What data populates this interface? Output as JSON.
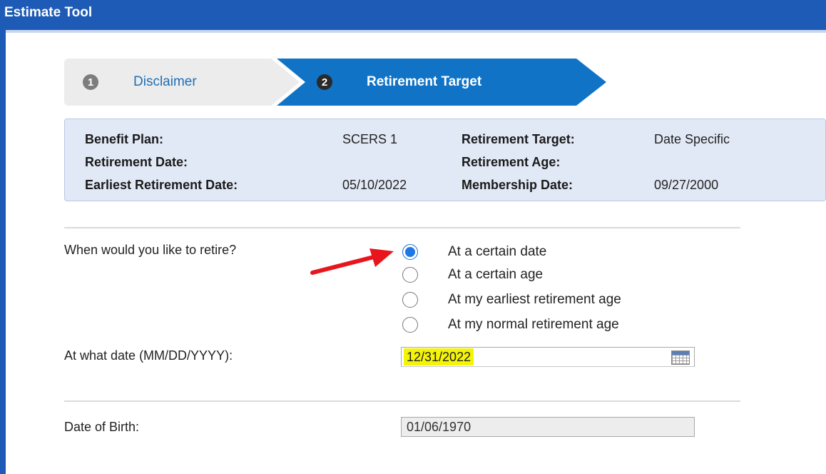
{
  "window": {
    "title": "Estimate Tool"
  },
  "steps": [
    {
      "number": "1",
      "label": "Disclaimer"
    },
    {
      "number": "2",
      "label": "Retirement Target"
    }
  ],
  "summary": {
    "benefit_plan_label": "Benefit Plan:",
    "benefit_plan_value": "SCERS 1",
    "retirement_target_label": "Retirement Target:",
    "retirement_target_value": "Date Specific",
    "retirement_date_label": "Retirement Date:",
    "retirement_date_value": "",
    "retirement_age_label": "Retirement Age:",
    "retirement_age_value": "",
    "earliest_retirement_date_label": "Earliest Retirement Date:",
    "earliest_retirement_date_value": "05/10/2022",
    "membership_date_label": "Membership Date:",
    "membership_date_value": "09/27/2000"
  },
  "form": {
    "retire_question": "When would you like to retire?",
    "retire_options": [
      {
        "label": "At a certain date",
        "selected": true
      },
      {
        "label": "At a certain age",
        "selected": false
      },
      {
        "label": "At my earliest retirement age",
        "selected": false
      },
      {
        "label": "At my normal retirement age",
        "selected": false
      }
    ],
    "date_label": "At what date (MM/DD/YYYY):",
    "date_value": "12/31/2022",
    "dob_label": "Date of Birth:",
    "dob_value": "01/06/1970"
  },
  "colors": {
    "titlebar": "#1d5bb6",
    "active_step": "#1173c6",
    "highlight": "#f4f408",
    "annotation_arrow": "#e8161c"
  },
  "icons": [
    "calendar-icon",
    "annotation-arrow-icon"
  ]
}
